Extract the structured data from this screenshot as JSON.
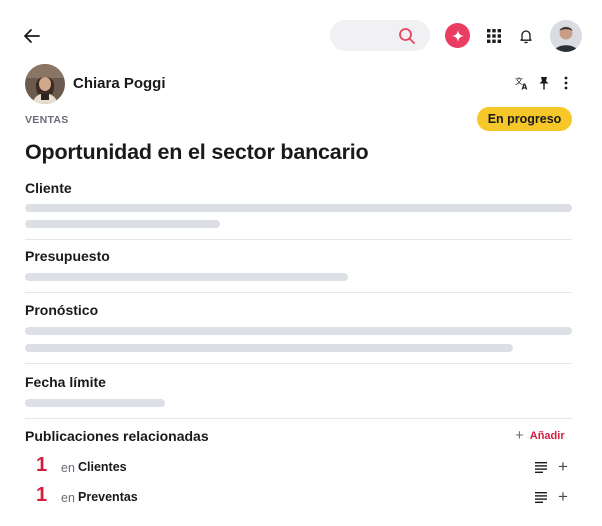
{
  "header": {
    "icons": [
      "back-arrow-icon",
      "search-icon",
      "ai-sparkle-icon",
      "apps-grid-icon",
      "bell-icon",
      "user-avatar"
    ],
    "accent_color": "#ea3d61"
  },
  "post": {
    "author_name": "Chiara Poggi",
    "tools": [
      "translate-icon",
      "pin-icon",
      "more-vertical-icon"
    ],
    "category": "VENTAS",
    "status": "En progreso",
    "status_color": "#f6c729",
    "title": "Oportunidad en el sector bancario"
  },
  "fields": [
    {
      "label": "Cliente"
    },
    {
      "label": "Presupuesto"
    },
    {
      "label": "Pronóstico"
    },
    {
      "label": "Fecha límite"
    }
  ],
  "related": {
    "title": "Publicaciones relacionadas",
    "add_label": "Añadir",
    "items": [
      {
        "count": "1",
        "in_label": "en",
        "name": "Clientes"
      },
      {
        "count": "1",
        "in_label": "en",
        "name": "Preventas"
      }
    ]
  }
}
